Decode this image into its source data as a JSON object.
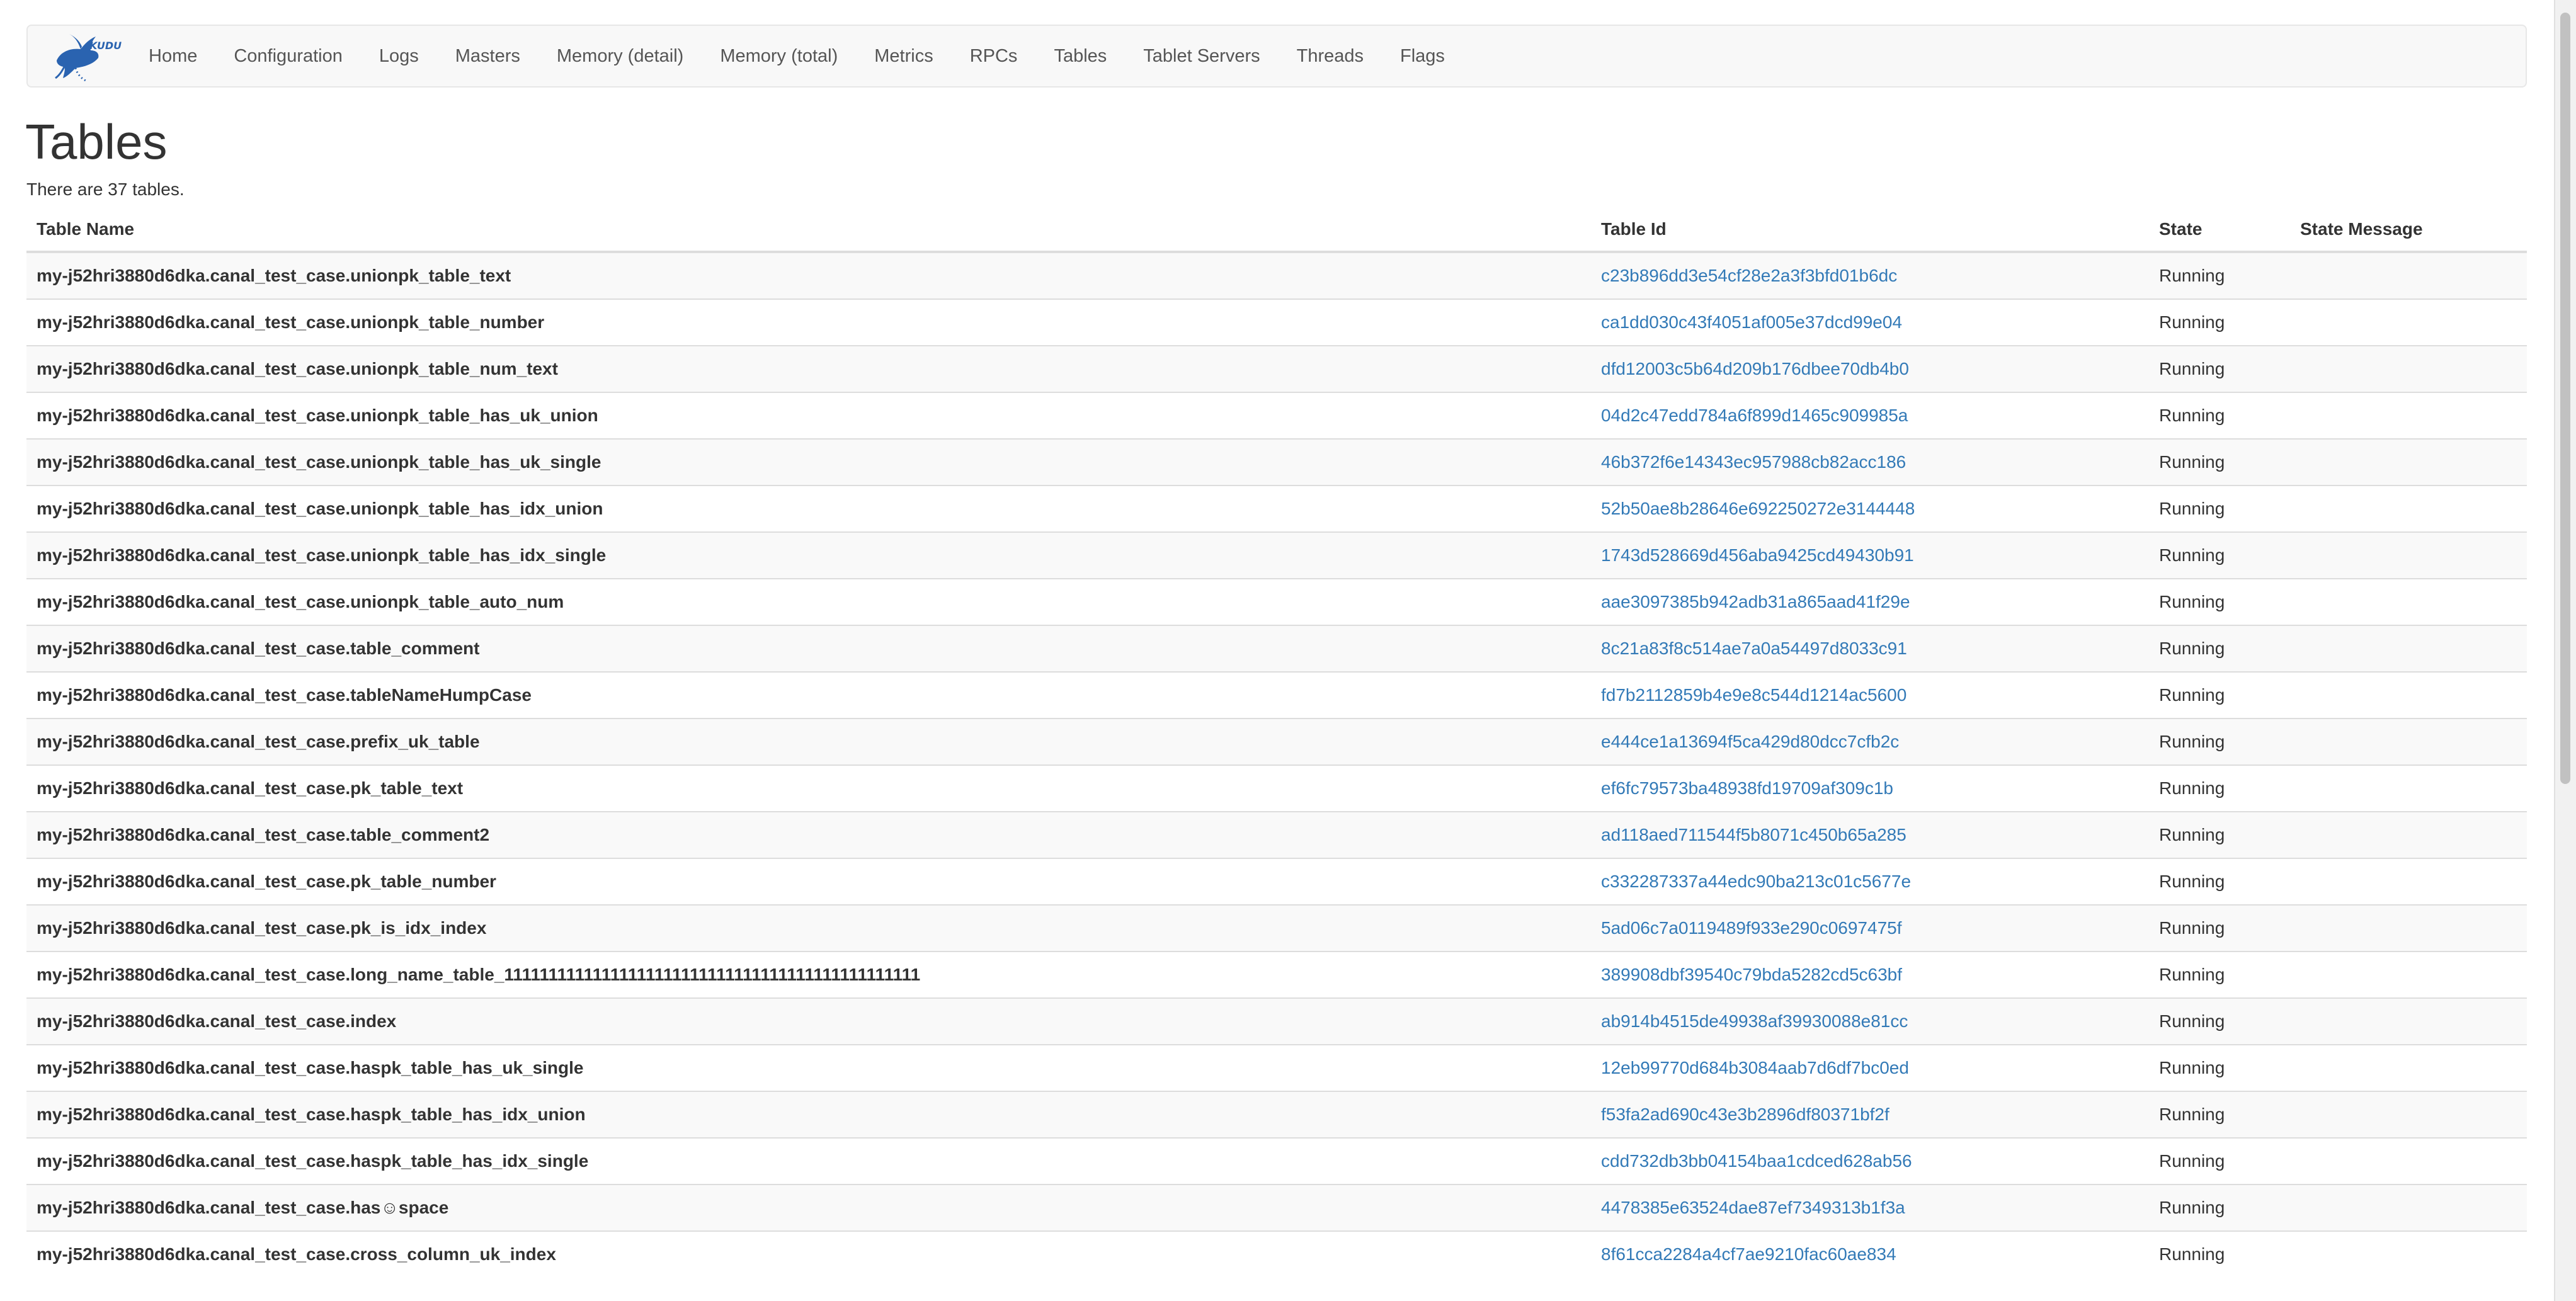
{
  "nav": {
    "brand": "KUDU",
    "items": [
      "Home",
      "Configuration",
      "Logs",
      "Masters",
      "Memory (detail)",
      "Memory (total)",
      "Metrics",
      "RPCs",
      "Tables",
      "Tablet Servers",
      "Threads",
      "Flags"
    ]
  },
  "page": {
    "title": "Tables",
    "summary": "There are 37 tables."
  },
  "table": {
    "headers": [
      "Table Name",
      "Table Id",
      "State",
      "State Message"
    ],
    "rows": [
      {
        "name": "my-j52hri3880d6dka.canal_test_case.unionpk_table_text",
        "id": "c23b896dd3e54cf28e2a3f3bfd01b6dc",
        "state": "Running",
        "message": ""
      },
      {
        "name": "my-j52hri3880d6dka.canal_test_case.unionpk_table_number",
        "id": "ca1dd030c43f4051af005e37dcd99e04",
        "state": "Running",
        "message": ""
      },
      {
        "name": "my-j52hri3880d6dka.canal_test_case.unionpk_table_num_text",
        "id": "dfd12003c5b64d209b176dbee70db4b0",
        "state": "Running",
        "message": ""
      },
      {
        "name": "my-j52hri3880d6dka.canal_test_case.unionpk_table_has_uk_union",
        "id": "04d2c47edd784a6f899d1465c909985a",
        "state": "Running",
        "message": ""
      },
      {
        "name": "my-j52hri3880d6dka.canal_test_case.unionpk_table_has_uk_single",
        "id": "46b372f6e14343ec957988cb82acc186",
        "state": "Running",
        "message": ""
      },
      {
        "name": "my-j52hri3880d6dka.canal_test_case.unionpk_table_has_idx_union",
        "id": "52b50ae8b28646e692250272e3144448",
        "state": "Running",
        "message": ""
      },
      {
        "name": "my-j52hri3880d6dka.canal_test_case.unionpk_table_has_idx_single",
        "id": "1743d528669d456aba9425cd49430b91",
        "state": "Running",
        "message": ""
      },
      {
        "name": "my-j52hri3880d6dka.canal_test_case.unionpk_table_auto_num",
        "id": "aae3097385b942adb31a865aad41f29e",
        "state": "Running",
        "message": ""
      },
      {
        "name": "my-j52hri3880d6dka.canal_test_case.table_comment",
        "id": "8c21a83f8c514ae7a0a54497d8033c91",
        "state": "Running",
        "message": ""
      },
      {
        "name": "my-j52hri3880d6dka.canal_test_case.tableNameHumpCase",
        "id": "fd7b2112859b4e9e8c544d1214ac5600",
        "state": "Running",
        "message": ""
      },
      {
        "name": "my-j52hri3880d6dka.canal_test_case.prefix_uk_table",
        "id": "e444ce1a13694f5ca429d80dcc7cfb2c",
        "state": "Running",
        "message": ""
      },
      {
        "name": "my-j52hri3880d6dka.canal_test_case.pk_table_text",
        "id": "ef6fc79573ba48938fd19709af309c1b",
        "state": "Running",
        "message": ""
      },
      {
        "name": "my-j52hri3880d6dka.canal_test_case.table_comment2",
        "id": "ad118aed711544f5b8071c450b65a285",
        "state": "Running",
        "message": ""
      },
      {
        "name": "my-j52hri3880d6dka.canal_test_case.pk_table_number",
        "id": "c332287337a44edc90ba213c01c5677e",
        "state": "Running",
        "message": ""
      },
      {
        "name": "my-j52hri3880d6dka.canal_test_case.pk_is_idx_index",
        "id": "5ad06c7a0119489f933e290c0697475f",
        "state": "Running",
        "message": ""
      },
      {
        "name": "my-j52hri3880d6dka.canal_test_case.long_name_table_11111111111111111111111111111111111111111111111",
        "id": "389908dbf39540c79bda5282cd5c63bf",
        "state": "Running",
        "message": ""
      },
      {
        "name": "my-j52hri3880d6dka.canal_test_case.index",
        "id": "ab914b4515de49938af39930088e81cc",
        "state": "Running",
        "message": ""
      },
      {
        "name": "my-j52hri3880d6dka.canal_test_case.haspk_table_has_uk_single",
        "id": "12eb99770d684b3084aab7d6df7bc0ed",
        "state": "Running",
        "message": ""
      },
      {
        "name": "my-j52hri3880d6dka.canal_test_case.haspk_table_has_idx_union",
        "id": "f53fa2ad690c43e3b2896df80371bf2f",
        "state": "Running",
        "message": ""
      },
      {
        "name": "my-j52hri3880d6dka.canal_test_case.haspk_table_has_idx_single",
        "id": "cdd732db3bb04154baa1cdced628ab56",
        "state": "Running",
        "message": ""
      },
      {
        "name": "my-j52hri3880d6dka.canal_test_case.has☺space",
        "id": "4478385e63524dae87ef7349313b1f3a",
        "state": "Running",
        "message": ""
      },
      {
        "name": "my-j52hri3880d6dka.canal_test_case.cross_column_uk_index",
        "id": "8f61cca2284a4cf7ae9210fac60ae834",
        "state": "Running",
        "message": ""
      }
    ]
  }
}
